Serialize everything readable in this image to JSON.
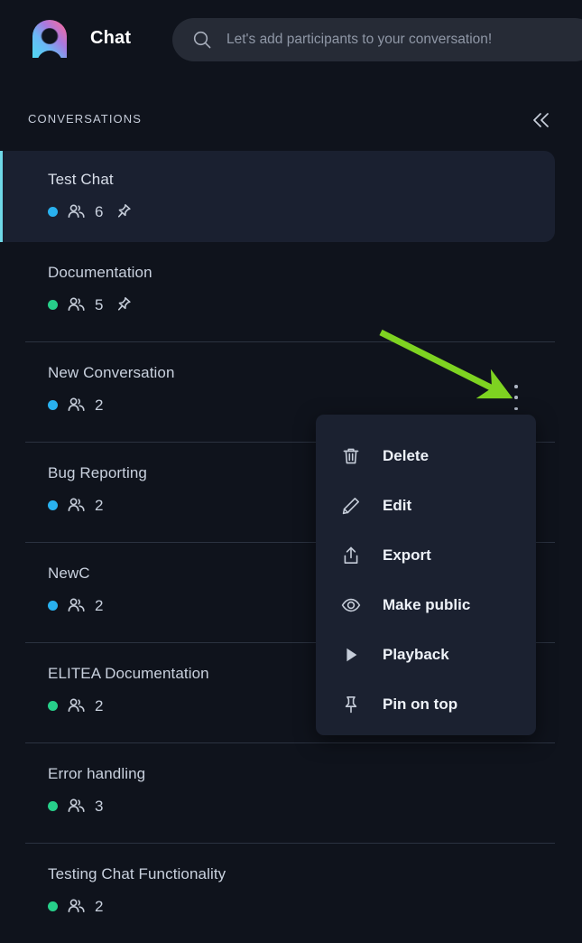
{
  "header": {
    "logo_icon": "elitea-logo-icon",
    "app_title": "Chat",
    "search": {
      "icon": "search-icon",
      "placeholder": "Let's add participants to your conversation!",
      "value": ""
    }
  },
  "sidebar": {
    "section_title": "CONVERSATIONS",
    "collapse_icon": "chevron-double-left-icon",
    "kebab_icon": "more-vertical-icon",
    "conversations": [
      {
        "title": "Test Chat",
        "status_color": "#29b1ef",
        "participants": "6",
        "pinned": true,
        "selected": true
      },
      {
        "title": "Documentation",
        "status_color": "#27cf8a",
        "participants": "5",
        "pinned": true,
        "selected": false
      },
      {
        "title": "New Conversation",
        "status_color": "#29b1ef",
        "participants": "2",
        "pinned": false,
        "selected": false
      },
      {
        "title": "Bug Reporting",
        "status_color": "#29b1ef",
        "participants": "2",
        "pinned": false,
        "selected": false
      },
      {
        "title": "NewC",
        "status_color": "#29b1ef",
        "participants": "2",
        "pinned": false,
        "selected": false
      },
      {
        "title": "ELITEA Documentation",
        "status_color": "#27cf8a",
        "participants": "2",
        "pinned": false,
        "selected": false
      },
      {
        "title": "Error handling",
        "status_color": "#27cf8a",
        "participants": "3",
        "pinned": false,
        "selected": false
      },
      {
        "title": "Testing Chat Functionality",
        "status_color": "#27cf8a",
        "participants": "2",
        "pinned": false,
        "selected": false
      }
    ]
  },
  "context_menu": {
    "items": [
      {
        "label": "Delete",
        "icon": "trash-icon"
      },
      {
        "label": "Edit",
        "icon": "pencil-icon"
      },
      {
        "label": "Export",
        "icon": "share-upload-icon"
      },
      {
        "label": "Make public",
        "icon": "eye-icon"
      },
      {
        "label": "Playback",
        "icon": "play-triangle-icon"
      },
      {
        "label": "Pin on top",
        "icon": "pin-icon"
      }
    ]
  },
  "annotation": {
    "arrow_color": "#7ed321",
    "arrow_from": "422,368",
    "arrow_to": "567,441"
  },
  "theme": {
    "background": "#0f131c",
    "selected_bg": "#1a2030",
    "accent_bar": "#6fd9e8",
    "menu_bg": "#1b2130",
    "divider": "#2b3240"
  }
}
